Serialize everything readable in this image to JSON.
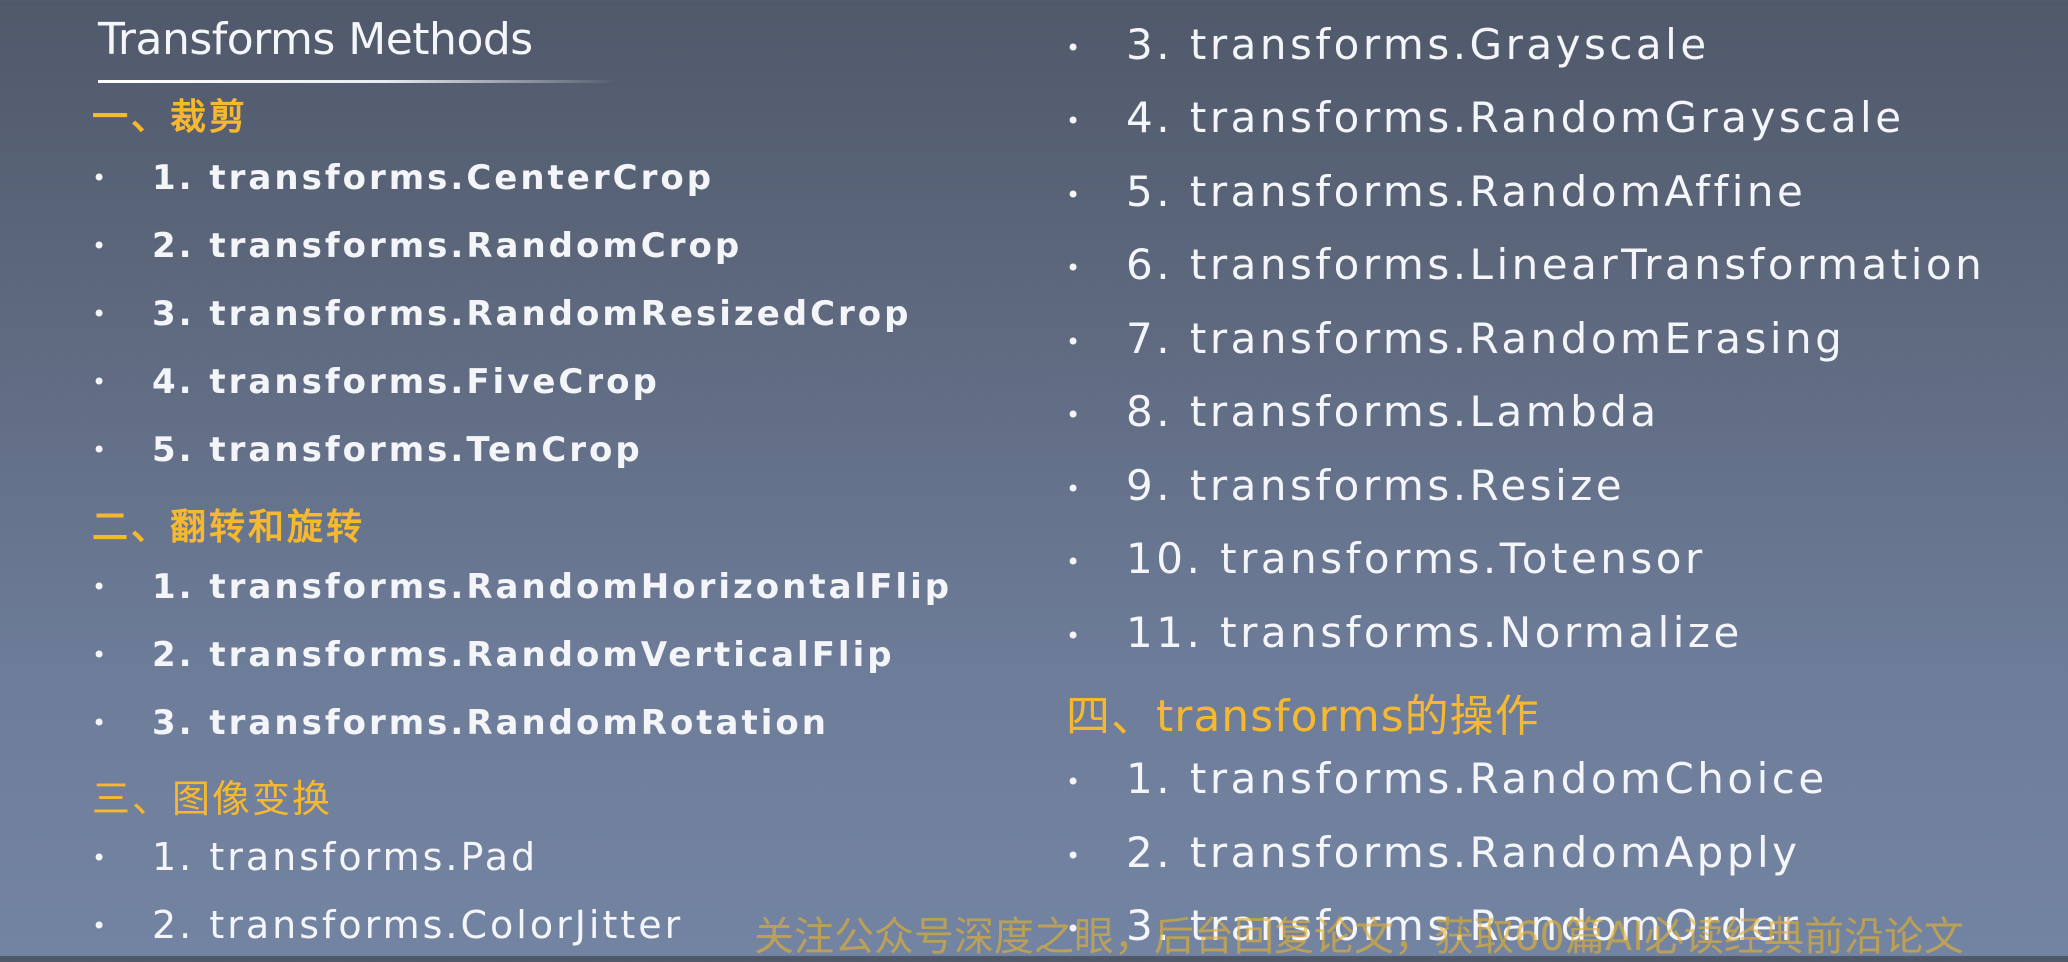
{
  "slide": {
    "title": "Transforms Methods"
  },
  "left_column": {
    "sections": [
      {
        "heading": "一、裁剪",
        "items": [
          "1. transforms.CenterCrop",
          "2. transforms.RandomCrop",
          "3. transforms.RandomResizedCrop",
          "4. transforms.FiveCrop",
          "5. transforms.TenCrop"
        ]
      },
      {
        "heading": "二、翻转和旋转",
        "items": [
          "1. transforms.RandomHorizontalFlip",
          "2. transforms.RandomVerticalFlip",
          "3. transforms.RandomRotation"
        ]
      },
      {
        "heading": "三、图像变换",
        "items": [
          "1. transforms.Pad",
          "2. transforms.ColorJitter"
        ]
      }
    ]
  },
  "right_column": {
    "items_before_heading": [
      "3. transforms.Grayscale",
      "4. transforms.RandomGrayscale",
      "5. transforms.RandomAffine",
      "6. transforms.LinearTransformation",
      "7. transforms.RandomErasing",
      "8. transforms.Lambda",
      "9. transforms.Resize",
      "10. transforms.Totensor",
      "11. transforms.Normalize"
    ],
    "heading": "四、transforms的操作",
    "items_after_heading": [
      "1. transforms.RandomChoice",
      "2. transforms.RandomApply",
      "3. transforms.RandomOrder"
    ]
  },
  "bullet_glyph": "•",
  "watermark": "关注公众号深度之眼，后台回复论文，获取60篇AI必读经典前沿论文",
  "colors": {
    "heading": "#f5b82e",
    "text": "#f3f5f8",
    "background_top": "#50596a",
    "background_bottom": "#7384a2",
    "watermark": "#e5b22c"
  }
}
